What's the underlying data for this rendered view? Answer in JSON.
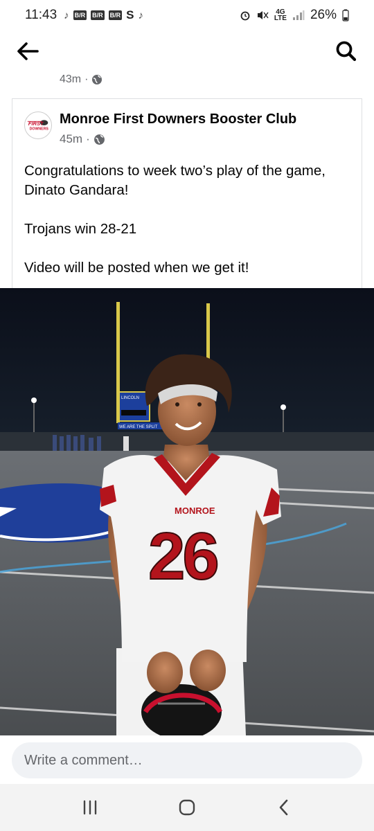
{
  "status_bar": {
    "time": "11:43",
    "app_badges": [
      "B/R",
      "B/R",
      "B/R"
    ],
    "network": "4G LTE",
    "battery": "26%"
  },
  "app_bar": {
    "back_icon": "arrow-left-icon",
    "search_icon": "search-icon"
  },
  "previous_post": {
    "time": "43m",
    "separator": "·"
  },
  "post": {
    "author": "Monroe First Downers Booster Club",
    "avatar_text_top": "FIRST",
    "avatar_text_bottom": "DOWNERS",
    "time": "45m",
    "separator": "·",
    "privacy_icon": "globe-icon",
    "paragraphs": [
      "Congratulations to week two’s play of the game, Dinato Gandara!",
      "Trojans win 28-21",
      "Video will be posted when we get it!"
    ]
  },
  "photo": {
    "jersey_team": "MONROE",
    "jersey_number": "26",
    "scoreboard_name": "LINCOLN",
    "banner_text": "WE ARE THE SPLIT"
  },
  "comment": {
    "placeholder": "Write a comment…"
  },
  "nav_bar": {
    "recents_icon": "recents-icon",
    "home_icon": "home-icon",
    "back_icon": "chevron-left-icon"
  },
  "colors": {
    "meta_gray": "#65676b",
    "jersey_red": "#b3141c",
    "field_blue": "#1f3f9a",
    "input_bg": "#f0f2f5"
  }
}
